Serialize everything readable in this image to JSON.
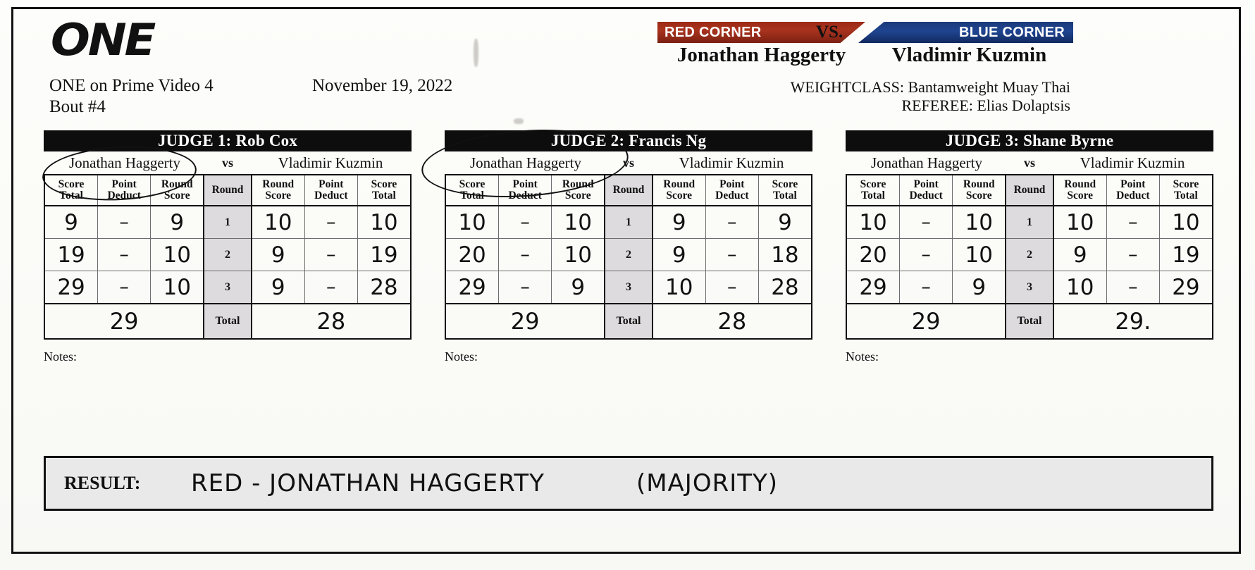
{
  "event": {
    "logo_text": "ONE",
    "name": "ONE on Prime Video 4",
    "bout": "Bout #4",
    "date": "November 19, 2022"
  },
  "matchup": {
    "red_corner_label": "RED CORNER",
    "blue_corner_label": "BLUE CORNER",
    "vs_label": "VS.",
    "red_fighter": "Jonathan Haggerty",
    "blue_fighter": "Vladimir Kuzmin",
    "weightclass_label": "WEIGHTCLASS:",
    "weightclass_value": "Bantamweight Muay Thai",
    "referee_label": "REFEREE:",
    "referee_value": "Elias Dolaptsis",
    "red_color": "#9d2a17",
    "blue_color": "#1f4490"
  },
  "table_headers": {
    "score_total": "Score\nTotal",
    "score_total_line1": "Score",
    "score_total_line2": "Total",
    "point_deduct_line1": "Point",
    "point_deduct_line2": "Deduct",
    "round_score_line1": "Round",
    "round_score_line2": "Score",
    "round": "Round",
    "total": "Total",
    "vs": "vs",
    "notes": "Notes:"
  },
  "judges": [
    {
      "title": "JUDGE 1: Rob Cox",
      "left_fighter": "Jonathan Haggerty",
      "right_fighter": "Vladimir Kuzmin",
      "rounds": [
        {
          "round": "1",
          "left_score_total": "9",
          "left_point_deduct": "–",
          "left_round_score": "9",
          "right_round_score": "10",
          "right_point_deduct": "–",
          "right_score_total": "10"
        },
        {
          "round": "2",
          "left_score_total": "19",
          "left_point_deduct": "–",
          "left_round_score": "10",
          "right_round_score": "9",
          "right_point_deduct": "–",
          "right_score_total": "19"
        },
        {
          "round": "3",
          "left_score_total": "29",
          "left_point_deduct": "–",
          "left_round_score": "10",
          "right_round_score": "9",
          "right_point_deduct": "–",
          "right_score_total": "28"
        }
      ],
      "left_total": "29",
      "right_total": "28"
    },
    {
      "title": "JUDGE 2: Francis Ng",
      "left_fighter": "Jonathan Haggerty",
      "right_fighter": "Vladimir Kuzmin",
      "rounds": [
        {
          "round": "1",
          "left_score_total": "10",
          "left_point_deduct": "–",
          "left_round_score": "10",
          "right_round_score": "9",
          "right_point_deduct": "–",
          "right_score_total": "9"
        },
        {
          "round": "2",
          "left_score_total": "20",
          "left_point_deduct": "–",
          "left_round_score": "10",
          "right_round_score": "9",
          "right_point_deduct": "–",
          "right_score_total": "18"
        },
        {
          "round": "3",
          "left_score_total": "29",
          "left_point_deduct": "–",
          "left_round_score": "9",
          "right_round_score": "10",
          "right_point_deduct": "–",
          "right_score_total": "28"
        }
      ],
      "left_total": "29",
      "right_total": "28"
    },
    {
      "title": "JUDGE 3: Shane Byrne",
      "left_fighter": "Jonathan Haggerty",
      "right_fighter": "Vladimir Kuzmin",
      "rounds": [
        {
          "round": "1",
          "left_score_total": "10",
          "left_point_deduct": "–",
          "left_round_score": "10",
          "right_round_score": "10",
          "right_point_deduct": "–",
          "right_score_total": "10"
        },
        {
          "round": "2",
          "left_score_total": "20",
          "left_point_deduct": "–",
          "left_round_score": "10",
          "right_round_score": "9",
          "right_point_deduct": "–",
          "right_score_total": "19"
        },
        {
          "round": "3",
          "left_score_total": "29",
          "left_point_deduct": "–",
          "left_round_score": "9",
          "right_round_score": "10",
          "right_point_deduct": "–",
          "right_score_total": "29"
        }
      ],
      "left_total": "29",
      "right_total": "29."
    }
  ],
  "result": {
    "label": "RESULT:",
    "winner": "RED - JONATHAN HAGGERTY",
    "method": "(MAJORITY)"
  }
}
